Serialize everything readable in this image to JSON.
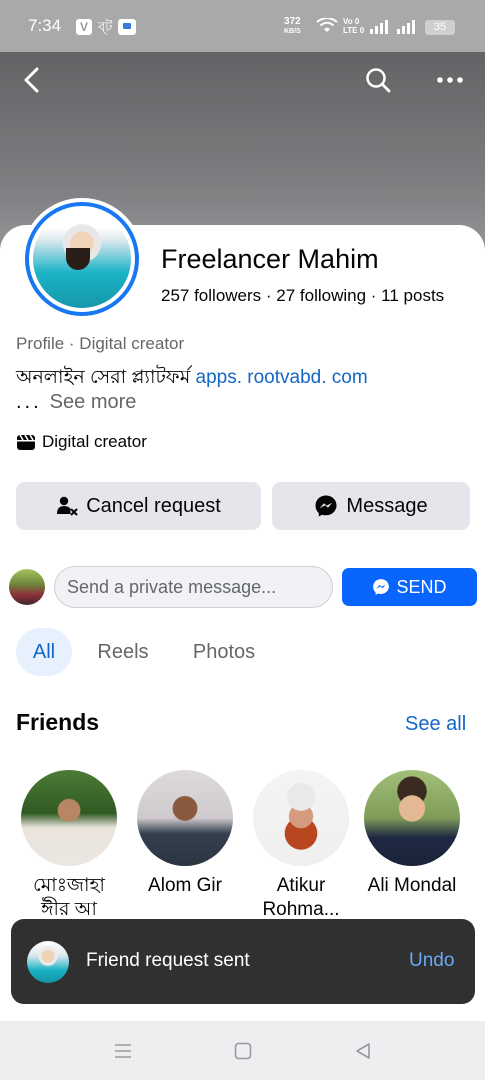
{
  "status_bar": {
    "time": "7:34",
    "carrier_badge": "V",
    "bengali_indicator": "ব্ট",
    "net_speed": "372",
    "net_speed_unit": "KB/S",
    "volte_label": "Vo 0 LTE 0",
    "battery": "35"
  },
  "header": {
    "back_icon": "back-arrow-icon",
    "search_icon": "search-icon",
    "more_icon": "more-horizontal-icon"
  },
  "profile": {
    "name": "Freelancer Mahim",
    "stats": "257 followers · 27 following · 11 posts",
    "category": "Profile · Digital creator",
    "bio_text": "অনলাইন সেরা প্ল্যাটফর্ম ",
    "bio_link": "apps. rootvabd. com",
    "see_more_dots": "...",
    "see_more_label": "See more",
    "creator_label": "Digital creator"
  },
  "actions": {
    "cancel_request_label": "Cancel request",
    "message_label": "Message"
  },
  "private_message": {
    "placeholder": "Send a private message...",
    "send_label": "SEND"
  },
  "tabs": [
    {
      "label": "All",
      "active": true
    },
    {
      "label": "Reels",
      "active": false
    },
    {
      "label": "Photos",
      "active": false
    }
  ],
  "friends": {
    "title": "Friends",
    "see_all_label": "See all",
    "items": [
      {
        "name": "মোঃজাহা ঈীর আ",
        "colors": [
          "#3a6b2c",
          "#e8e2dc"
        ]
      },
      {
        "name": "Alom Gir",
        "colors": [
          "#d8d6d8",
          "#2f3a4a"
        ]
      },
      {
        "name": "Atikur Rohma...",
        "colors": [
          "#f2f2f2",
          "#c6522f"
        ]
      },
      {
        "name": "Ali Mondal",
        "colors": [
          "#9ab76a",
          "#1e2640"
        ]
      }
    ]
  },
  "toast": {
    "message": "Friend request sent",
    "undo_label": "Undo"
  },
  "colors": {
    "accent": "#1877f2",
    "link": "#1367c7",
    "send_button": "#0866ff",
    "toast_bg": "#303031"
  }
}
